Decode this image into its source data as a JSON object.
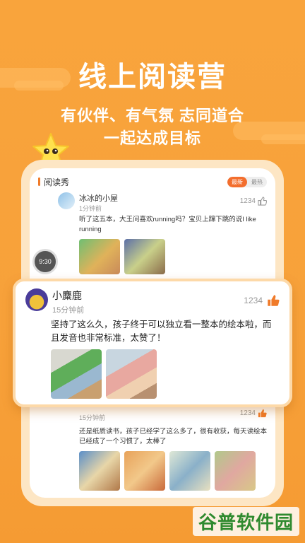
{
  "hero": {
    "title": "线上阅读营",
    "subtitle_line1": "有伙伴、有气氛 志同道合",
    "subtitle_line2": "一起达成目标"
  },
  "section": {
    "title": "阅读秀",
    "tab_active": "最新",
    "tab_inactive": "最热"
  },
  "post1": {
    "user": "冰冰的小屋",
    "time": "1分钟前",
    "likes": "1234",
    "text": "听了这五本，大王问喜欢running吗？宝贝上蹿下跳的说I like running"
  },
  "clock_text": "9:30",
  "featured": {
    "user": "小麋鹿",
    "time": "15分钟前",
    "likes": "1234",
    "text": "坚持了这么久，孩子终于可以独立看一整本的绘本啦，而且发音也非常标准，太赞了！"
  },
  "post3": {
    "time": "15分钟前",
    "likes": "1234",
    "text": "还是纸质读书，孩子已经学了这么多了，很有收获，每天读绘本已经成了一个习惯了，太棒了"
  },
  "watermark": "谷普软件园",
  "colors": {
    "background": "#f9a43a",
    "accent": "#f36e2d",
    "like": "#f07b2a"
  }
}
